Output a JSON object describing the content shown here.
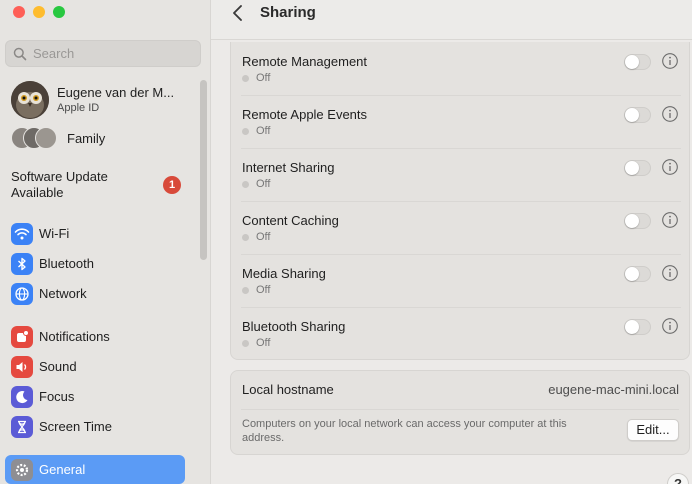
{
  "sidebar": {
    "search": {
      "placeholder": "Search"
    },
    "account": {
      "name": "Eugene van der M...",
      "subtitle": "Apple ID"
    },
    "family": {
      "label": "Family"
    },
    "software_update": {
      "label": "Software Update Available",
      "badge": "1"
    },
    "items": [
      {
        "label": "Wi-Fi",
        "icon": "wifi-icon",
        "color": "#3b82f6"
      },
      {
        "label": "Bluetooth",
        "icon": "bluetooth-icon",
        "color": "#3b82f6"
      },
      {
        "label": "Network",
        "icon": "globe-icon",
        "color": "#3b82f6"
      },
      {
        "label": "Notifications",
        "icon": "bell-icon",
        "color": "#e5493f"
      },
      {
        "label": "Sound",
        "icon": "speaker-icon",
        "color": "#e5493f"
      },
      {
        "label": "Focus",
        "icon": "moon-icon",
        "color": "#5b5bd6"
      },
      {
        "label": "Screen Time",
        "icon": "hourglass-icon",
        "color": "#5b5bd6"
      },
      {
        "label": "General",
        "icon": "gear-icon",
        "color": "#8e8e93",
        "active": true
      }
    ]
  },
  "header": {
    "title": "Sharing"
  },
  "services": [
    {
      "name": "Remote Management",
      "status": "Off"
    },
    {
      "name": "Remote Apple Events",
      "status": "Off"
    },
    {
      "name": "Internet Sharing",
      "status": "Off"
    },
    {
      "name": "Content Caching",
      "status": "Off"
    },
    {
      "name": "Media Sharing",
      "status": "Off"
    },
    {
      "name": "Bluetooth Sharing",
      "status": "Off"
    }
  ],
  "hostname": {
    "label": "Local hostname",
    "value": "eugene-mac-mini.local",
    "description": "Computers on your local network can access your computer at this address.",
    "edit_label": "Edit..."
  },
  "help": {
    "label": "?"
  },
  "colors": {
    "accent": "#5b9bf5",
    "badge": "#d84a3a"
  }
}
